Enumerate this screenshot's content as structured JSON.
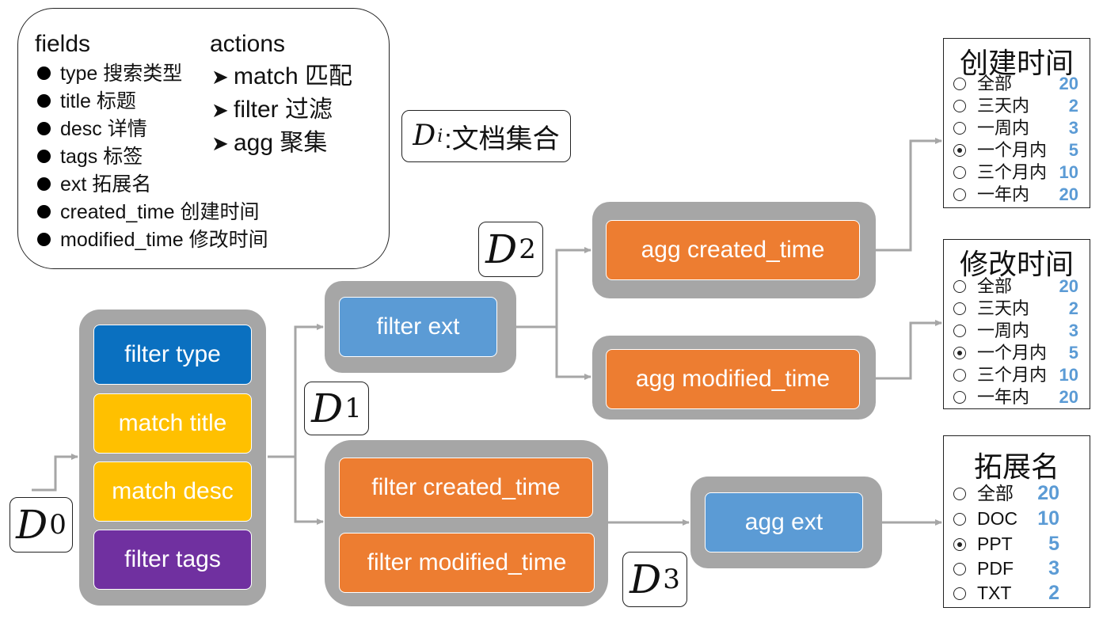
{
  "legend": {
    "fields_heading": "fields",
    "actions_heading": "actions",
    "fields": [
      "type 搜索类型",
      "title 标题",
      "desc 详情",
      "tags 标签",
      "ext 拓展名",
      "created_time 创建时间",
      "modified_time 修改时间"
    ],
    "actions": [
      "match 匹配",
      "filter 过滤",
      "agg 聚集"
    ]
  },
  "doc_set_label": {
    "symbol": "D",
    "subscript": "i",
    "text": ":文档集合"
  },
  "d_labels": [
    {
      "symbol": "D",
      "subscript": "0"
    },
    {
      "symbol": "D",
      "subscript": "1"
    },
    {
      "symbol": "D",
      "subscript": "2"
    },
    {
      "symbol": "D",
      "subscript": "3"
    }
  ],
  "stage1_nodes": [
    "filter type",
    "match title",
    "match desc",
    "filter tags"
  ],
  "filter_ext_node": "filter ext",
  "agg_created_node": "agg created_time",
  "agg_modified_node": "agg modified_time",
  "time_filter_nodes": [
    "filter created_time",
    "filter modified_time"
  ],
  "agg_ext_node": "agg ext",
  "facets": [
    {
      "title": "创建时间",
      "items": [
        {
          "label": "全部",
          "count": "20",
          "selected": false
        },
        {
          "label": "三天内",
          "count": "2",
          "selected": false
        },
        {
          "label": "一周内",
          "count": "3",
          "selected": false
        },
        {
          "label": "一个月内",
          "count": "5",
          "selected": true
        },
        {
          "label": "三个月内",
          "count": "10",
          "selected": false
        },
        {
          "label": "一年内",
          "count": "20",
          "selected": false
        }
      ]
    },
    {
      "title": "修改时间",
      "items": [
        {
          "label": "全部",
          "count": "20",
          "selected": false
        },
        {
          "label": "三天内",
          "count": "2",
          "selected": false
        },
        {
          "label": "一周内",
          "count": "3",
          "selected": false
        },
        {
          "label": "一个月内",
          "count": "5",
          "selected": true
        },
        {
          "label": "三个月内",
          "count": "10",
          "selected": false
        },
        {
          "label": "一年内",
          "count": "20",
          "selected": false
        }
      ]
    },
    {
      "title": "拓展名",
      "items": [
        {
          "label": "全部",
          "count": "20",
          "selected": false
        },
        {
          "label": "DOC",
          "count": "10",
          "selected": false
        },
        {
          "label": "PPT",
          "count": "5",
          "selected": true
        },
        {
          "label": "PDF",
          "count": "3",
          "selected": false
        },
        {
          "label": "TXT",
          "count": "2",
          "selected": false
        }
      ]
    }
  ],
  "colors": {
    "group_gray": "#a6a6a6",
    "connector": "#a6a6a6",
    "filter_type": "#0a70c0",
    "match": "#ffc000",
    "filter_tags": "#7030a0",
    "blue_node": "#5b9bd5",
    "orange_node": "#ed7d31",
    "facet_count": "#5b9bd5"
  }
}
